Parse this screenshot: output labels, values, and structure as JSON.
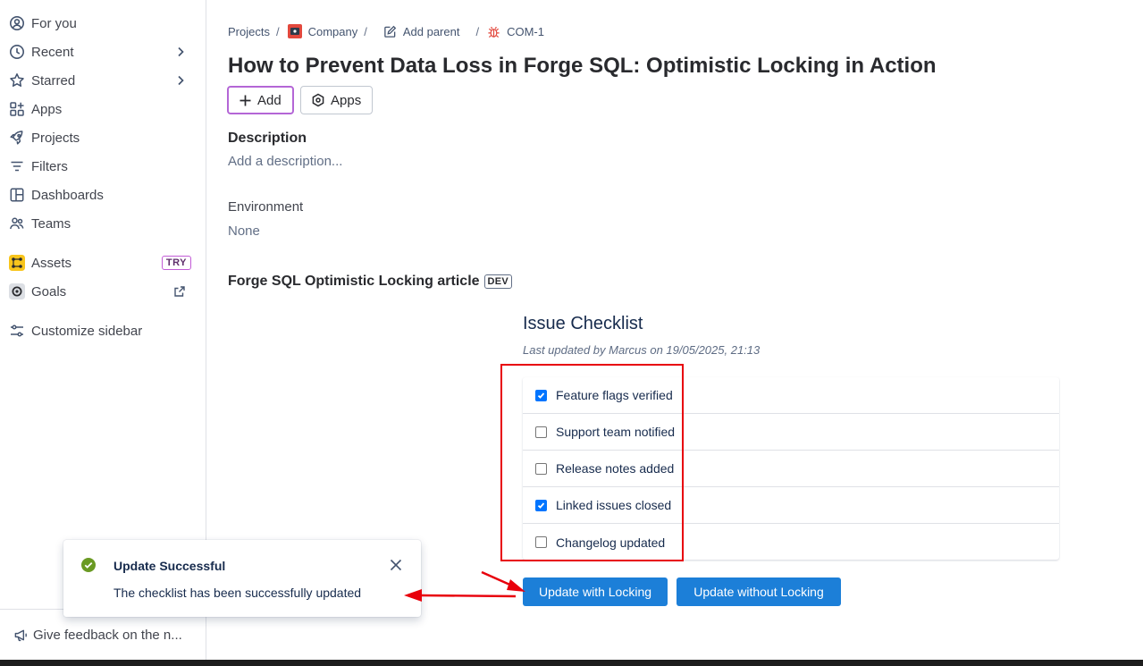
{
  "sidebar": {
    "items": [
      {
        "label": "For you",
        "icon": "user-circle-icon"
      },
      {
        "label": "Recent",
        "icon": "clock-icon",
        "has_chevron": true
      },
      {
        "label": "Starred",
        "icon": "star-icon",
        "has_chevron": true
      },
      {
        "label": "Apps",
        "icon": "apps-grid-icon"
      },
      {
        "label": "Projects",
        "icon": "rocket-icon"
      },
      {
        "label": "Filters",
        "icon": "filter-icon"
      },
      {
        "label": "Dashboards",
        "icon": "dashboard-icon"
      },
      {
        "label": "Teams",
        "icon": "people-icon"
      }
    ],
    "assets": {
      "label": "Assets",
      "badge": "TRY",
      "icon": "assets-icon"
    },
    "goals": {
      "label": "Goals",
      "icon": "goals-icon"
    },
    "customize": {
      "label": "Customize sidebar",
      "icon": "sliders-icon"
    },
    "feedback": {
      "label": "Give feedback on the n...",
      "icon": "megaphone-icon"
    }
  },
  "breadcrumb": {
    "projects": "Projects",
    "company": "Company",
    "add_parent": "Add parent",
    "issue_key": "COM-1"
  },
  "issue": {
    "title": "How to Prevent Data Loss in Forge SQL: Optimistic Locking in Action",
    "add_label": "Add",
    "apps_label": "Apps",
    "description_heading": "Description",
    "description_placeholder": "Add a description...",
    "environment_label": "Environment",
    "environment_value": "None",
    "app_title": "Forge SQL Optimistic Locking article",
    "app_badge": "DEV"
  },
  "checklist": {
    "title": "Issue Checklist",
    "updated": "Last updated by Marcus on 19/05/2025, 21:13",
    "items": [
      {
        "label": "Feature flags verified",
        "checked": true
      },
      {
        "label": "Support team notified",
        "checked": false
      },
      {
        "label": "Release notes added",
        "checked": false
      },
      {
        "label": "Linked issues closed",
        "checked": true
      },
      {
        "label": "Changelog updated",
        "checked": false
      }
    ],
    "update_locking": "Update with Locking",
    "update_no_locking": "Update without Locking"
  },
  "toast": {
    "title": "Update Successful",
    "message": "The checklist has been successfully updated"
  },
  "colors": {
    "primary_button": "#1c7fd8",
    "annotation_red": "#e8000b",
    "success_green": "#22a06b",
    "checkbox_blue": "#0075ff"
  }
}
